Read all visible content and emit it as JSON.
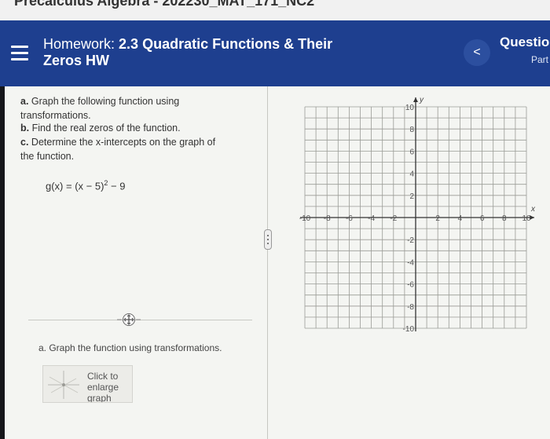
{
  "browser": {
    "partial_title": "Precalculus Algebra - 202230_MAT_171_NC2"
  },
  "header": {
    "menu_icon": "hamburger-icon",
    "title_prefix": "Homework:",
    "title_main": "2.3 Quadratic Functions & Their",
    "title_line2": "Zeros HW",
    "back_icon": "chevron-left-icon",
    "back_label": "<",
    "question_label": "Questio",
    "part_label": "Part"
  },
  "problem": {
    "line_a_label": "a.",
    "line_a1": "Graph the following function using",
    "line_a2": "transformations.",
    "line_b_label": "b.",
    "line_b": "Find the real zeros of the function.",
    "line_c_label": "c.",
    "line_c1": "Determine the x-intercepts on the graph of",
    "line_c2": "the function.",
    "formula_left": "g(x) = (x − 5)",
    "formula_exp": "2",
    "formula_right": " − 9",
    "part_a_instruction": "a. Graph the function using transformations."
  },
  "enlarge_button": {
    "line1": "Click to",
    "line2": "enlarge",
    "line3": "graph"
  },
  "icons": {
    "move": "move-arrows-icon",
    "resize": "resize-handle-icon"
  },
  "colors": {
    "header_bg": "#1e3f8f",
    "content_bg": "#f4f5f2",
    "grid": "#9a9b96"
  },
  "chart_data": {
    "type": "scatter",
    "title": "",
    "x_axis_label": "x",
    "y_axis_label": "y",
    "xlim": [
      -10,
      10
    ],
    "ylim": [
      -10,
      10
    ],
    "grid_step": 1,
    "grid": true,
    "x_ticks": [
      -10,
      -8,
      -6,
      -4,
      -2,
      2,
      4,
      6,
      8,
      10
    ],
    "y_ticks": [
      10,
      8,
      6,
      4,
      2,
      -2,
      -4,
      -6,
      -8,
      -10
    ],
    "series": []
  }
}
